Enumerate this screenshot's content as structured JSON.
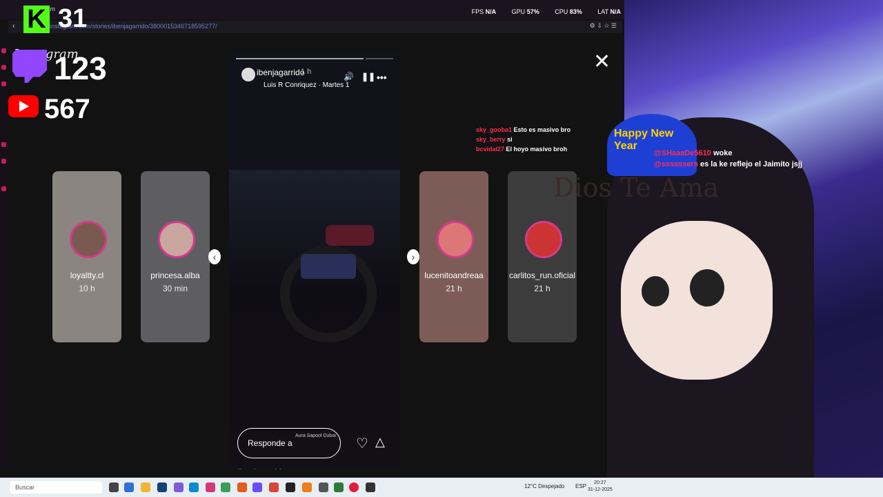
{
  "browser": {
    "tab_title": "Instagram",
    "url": "instagram.com/stories/ibenjagarrido/3800015346718595277/"
  },
  "stats": {
    "fps_label": "FPS",
    "fps_value": "N/A",
    "gpu_label": "GPU",
    "gpu_value": "57%",
    "cpu_label": "CPU",
    "cpu_value": "83%",
    "lat_label": "LAT",
    "lat_value": "N/A"
  },
  "counters": {
    "kick_letter": "K",
    "kick_count": "31",
    "twitch_count": "123",
    "youtube_count": "567",
    "instagram_text": "Instagram"
  },
  "story": {
    "username": "ibenjagarrido",
    "time": "1 h",
    "music": "Luis R Conriquez · Martes 1",
    "reply_placeholder": "Responde a ibenjagarrido...",
    "location": "Aura Sapool Dubai"
  },
  "side_stories": [
    {
      "name": "loyaltty.cl",
      "time": "10 h"
    },
    {
      "name": "princesa.alba",
      "time": "30 min"
    },
    {
      "name": "lucenitoandreaa",
      "time": "21 h"
    },
    {
      "name": "carlitos_run.oficial",
      "time": "21 h"
    }
  ],
  "chat": [
    {
      "user": "sky_gooba1",
      "msg": "Esto es masivo bro"
    },
    {
      "user": "sky_berry",
      "msg": "si"
    },
    {
      "user": "bcvidal27",
      "msg": "El hoyo masivo broh"
    }
  ],
  "chat2": [
    {
      "user": "@SHaaaDe5610",
      "msg": "woke"
    },
    {
      "user": "@ssssssers",
      "msg": "es la ke reflejo el Jaimito jsjj"
    }
  ],
  "overlay_text": "Dios Te Ama",
  "hat_text": "Happy New Year",
  "taskbar": {
    "search_placeholder": "Buscar",
    "weather": "12°C  Despejado",
    "lang": "ESP",
    "time": "20:27",
    "date": "31-12-2025"
  }
}
